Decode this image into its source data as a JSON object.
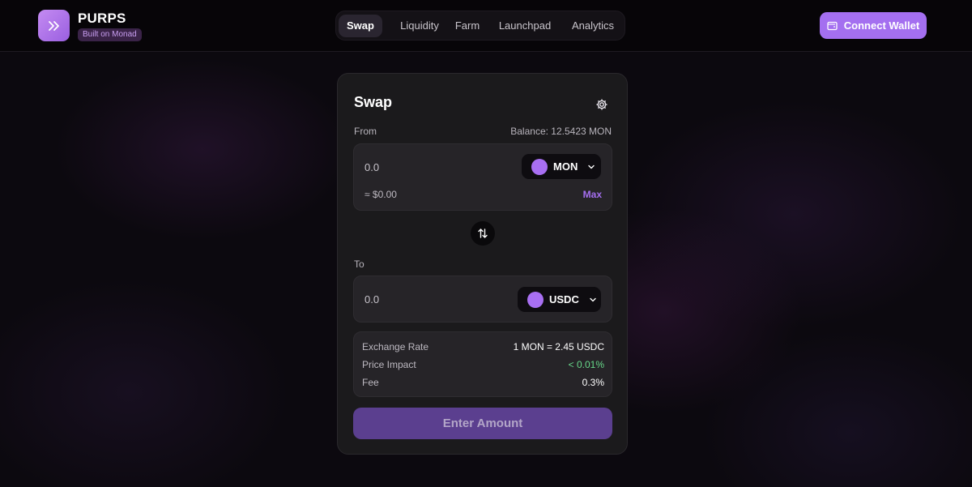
{
  "brand": {
    "name": "PURPS",
    "tagline": "Built on Monad",
    "logo_icon": "chevrons-right-icon"
  },
  "nav": {
    "tabs": [
      {
        "label": "Swap",
        "active": true
      },
      {
        "label": "Liquidity",
        "active": false
      },
      {
        "label": "Farm",
        "active": false
      },
      {
        "label": "Launchpad",
        "active": false
      },
      {
        "label": "Analytics",
        "active": false
      }
    ]
  },
  "header": {
    "connect_label": "Connect Wallet",
    "connect_icon": "wallet-icon"
  },
  "swap": {
    "title": "Swap",
    "settings_icon": "gear-icon",
    "from": {
      "label": "From",
      "balance": "Balance: 12.5423 MON",
      "amount": "0.0",
      "token": "MON",
      "usd_value": "≈ $0.00",
      "max_label": "Max"
    },
    "flip_icon": "swap-arrows-icon",
    "to": {
      "label": "To",
      "amount": "0.0",
      "token": "USDC"
    },
    "details": {
      "exchange_rate_label": "Exchange Rate",
      "exchange_rate_value": "1 MON = 2.45 USDC",
      "price_impact_label": "Price Impact",
      "price_impact_value": "< 0.01%",
      "fee_label": "Fee",
      "fee_value": "0.3%"
    },
    "submit_label": "Enter Amount"
  },
  "colors": {
    "accent": "#a46ff0",
    "positive": "#67d98a",
    "card": "#1b1a1c"
  }
}
